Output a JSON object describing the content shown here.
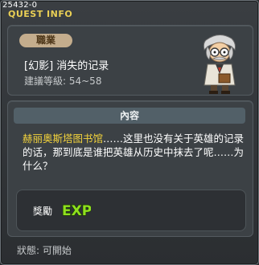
{
  "window": {
    "id_tag": "25432-0",
    "title": "QUEST INFO"
  },
  "quest": {
    "job_badge": "職業",
    "name": "[幻影] 消失的记录",
    "level": "建議等級: 54~58"
  },
  "content": {
    "header": "內容",
    "highlight": "赫丽奥斯塔图书馆",
    "text": "……这里也没有关于英雄的记录的话，那到底是谁把英雄从历史中抹去了呢……为什么？"
  },
  "reward": {
    "label": "獎勵",
    "exp_text": "EXP",
    "exp_colors": {
      "fill": "#8fe01e",
      "outline": "#1c3a06"
    }
  },
  "status": {
    "text": "狀態:  可開始"
  },
  "icons": {
    "npc": "scholar-npc-icon",
    "exp": "exp-icon"
  }
}
